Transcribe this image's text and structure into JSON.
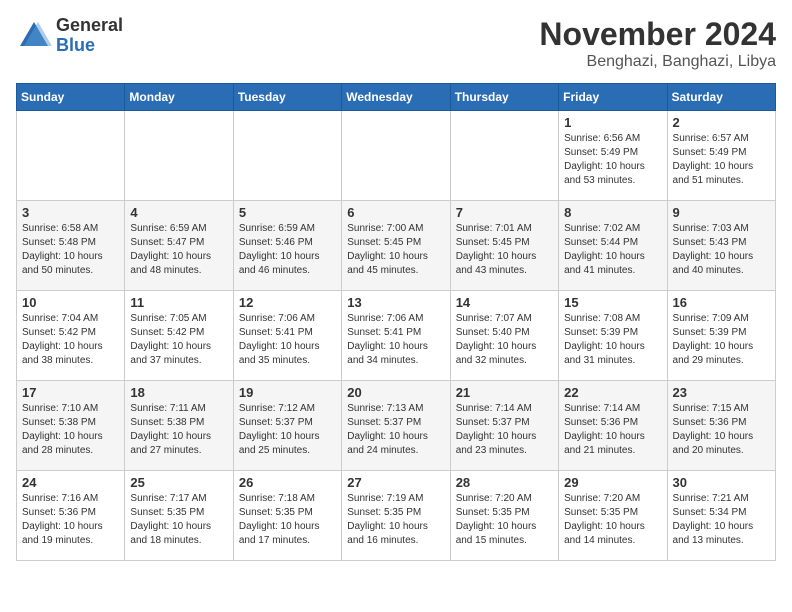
{
  "header": {
    "logo_general": "General",
    "logo_blue": "Blue",
    "month_title": "November 2024",
    "location": "Benghazi, Banghazi, Libya"
  },
  "days_of_week": [
    "Sunday",
    "Monday",
    "Tuesday",
    "Wednesday",
    "Thursday",
    "Friday",
    "Saturday"
  ],
  "weeks": [
    [
      {
        "day": "",
        "info": ""
      },
      {
        "day": "",
        "info": ""
      },
      {
        "day": "",
        "info": ""
      },
      {
        "day": "",
        "info": ""
      },
      {
        "day": "",
        "info": ""
      },
      {
        "day": "1",
        "info": "Sunrise: 6:56 AM\nSunset: 5:49 PM\nDaylight: 10 hours and 53 minutes."
      },
      {
        "day": "2",
        "info": "Sunrise: 6:57 AM\nSunset: 5:49 PM\nDaylight: 10 hours and 51 minutes."
      }
    ],
    [
      {
        "day": "3",
        "info": "Sunrise: 6:58 AM\nSunset: 5:48 PM\nDaylight: 10 hours and 50 minutes."
      },
      {
        "day": "4",
        "info": "Sunrise: 6:59 AM\nSunset: 5:47 PM\nDaylight: 10 hours and 48 minutes."
      },
      {
        "day": "5",
        "info": "Sunrise: 6:59 AM\nSunset: 5:46 PM\nDaylight: 10 hours and 46 minutes."
      },
      {
        "day": "6",
        "info": "Sunrise: 7:00 AM\nSunset: 5:45 PM\nDaylight: 10 hours and 45 minutes."
      },
      {
        "day": "7",
        "info": "Sunrise: 7:01 AM\nSunset: 5:45 PM\nDaylight: 10 hours and 43 minutes."
      },
      {
        "day": "8",
        "info": "Sunrise: 7:02 AM\nSunset: 5:44 PM\nDaylight: 10 hours and 41 minutes."
      },
      {
        "day": "9",
        "info": "Sunrise: 7:03 AM\nSunset: 5:43 PM\nDaylight: 10 hours and 40 minutes."
      }
    ],
    [
      {
        "day": "10",
        "info": "Sunrise: 7:04 AM\nSunset: 5:42 PM\nDaylight: 10 hours and 38 minutes."
      },
      {
        "day": "11",
        "info": "Sunrise: 7:05 AM\nSunset: 5:42 PM\nDaylight: 10 hours and 37 minutes."
      },
      {
        "day": "12",
        "info": "Sunrise: 7:06 AM\nSunset: 5:41 PM\nDaylight: 10 hours and 35 minutes."
      },
      {
        "day": "13",
        "info": "Sunrise: 7:06 AM\nSunset: 5:41 PM\nDaylight: 10 hours and 34 minutes."
      },
      {
        "day": "14",
        "info": "Sunrise: 7:07 AM\nSunset: 5:40 PM\nDaylight: 10 hours and 32 minutes."
      },
      {
        "day": "15",
        "info": "Sunrise: 7:08 AM\nSunset: 5:39 PM\nDaylight: 10 hours and 31 minutes."
      },
      {
        "day": "16",
        "info": "Sunrise: 7:09 AM\nSunset: 5:39 PM\nDaylight: 10 hours and 29 minutes."
      }
    ],
    [
      {
        "day": "17",
        "info": "Sunrise: 7:10 AM\nSunset: 5:38 PM\nDaylight: 10 hours and 28 minutes."
      },
      {
        "day": "18",
        "info": "Sunrise: 7:11 AM\nSunset: 5:38 PM\nDaylight: 10 hours and 27 minutes."
      },
      {
        "day": "19",
        "info": "Sunrise: 7:12 AM\nSunset: 5:37 PM\nDaylight: 10 hours and 25 minutes."
      },
      {
        "day": "20",
        "info": "Sunrise: 7:13 AM\nSunset: 5:37 PM\nDaylight: 10 hours and 24 minutes."
      },
      {
        "day": "21",
        "info": "Sunrise: 7:14 AM\nSunset: 5:37 PM\nDaylight: 10 hours and 23 minutes."
      },
      {
        "day": "22",
        "info": "Sunrise: 7:14 AM\nSunset: 5:36 PM\nDaylight: 10 hours and 21 minutes."
      },
      {
        "day": "23",
        "info": "Sunrise: 7:15 AM\nSunset: 5:36 PM\nDaylight: 10 hours and 20 minutes."
      }
    ],
    [
      {
        "day": "24",
        "info": "Sunrise: 7:16 AM\nSunset: 5:36 PM\nDaylight: 10 hours and 19 minutes."
      },
      {
        "day": "25",
        "info": "Sunrise: 7:17 AM\nSunset: 5:35 PM\nDaylight: 10 hours and 18 minutes."
      },
      {
        "day": "26",
        "info": "Sunrise: 7:18 AM\nSunset: 5:35 PM\nDaylight: 10 hours and 17 minutes."
      },
      {
        "day": "27",
        "info": "Sunrise: 7:19 AM\nSunset: 5:35 PM\nDaylight: 10 hours and 16 minutes."
      },
      {
        "day": "28",
        "info": "Sunrise: 7:20 AM\nSunset: 5:35 PM\nDaylight: 10 hours and 15 minutes."
      },
      {
        "day": "29",
        "info": "Sunrise: 7:20 AM\nSunset: 5:35 PM\nDaylight: 10 hours and 14 minutes."
      },
      {
        "day": "30",
        "info": "Sunrise: 7:21 AM\nSunset: 5:34 PM\nDaylight: 10 hours and 13 minutes."
      }
    ]
  ]
}
